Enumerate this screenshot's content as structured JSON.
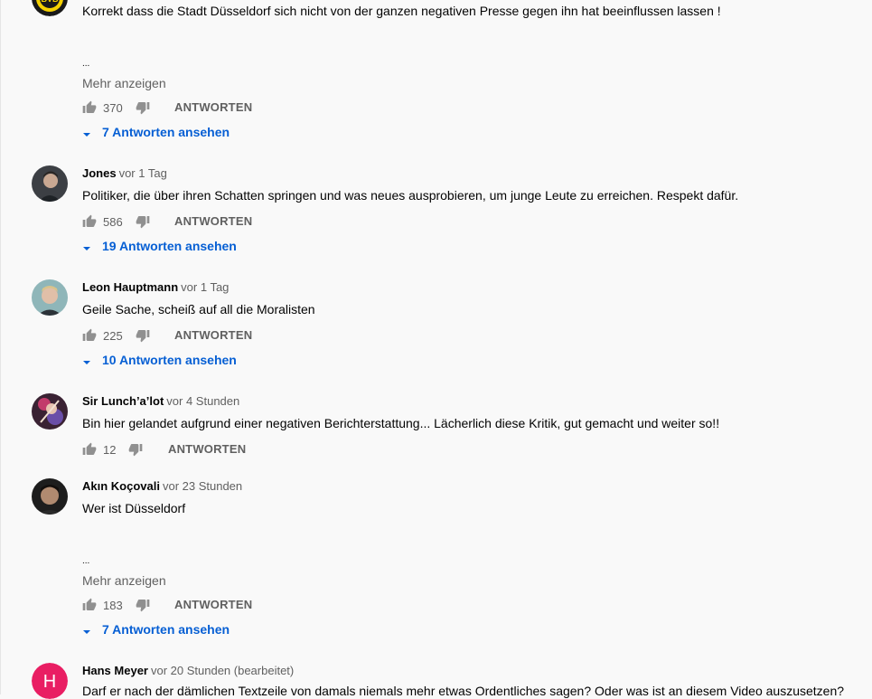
{
  "comments": [
    {
      "author": "",
      "time": "",
      "text": "Korrekt dass die Stadt Düsseldorf sich nicht von der ganzen negativen Presse gegen ihn hat beeinflussen lassen !",
      "ellipsis": "...",
      "show_more": "Mehr anzeigen",
      "likes": "370",
      "reply_label": "ANTWORTEN",
      "replies": "7 Antworten ansehen",
      "avatar_icon": "bvb-logo-avatar"
    },
    {
      "author": "Jones",
      "time": "vor 1 Tag",
      "text": "Politiker, die über ihren Schatten springen und was neues ausprobieren, um junge Leute zu erreichen. Respekt dafür.",
      "likes": "586",
      "reply_label": "ANTWORTEN",
      "replies": "19 Antworten ansehen",
      "avatar_icon": "user-photo-avatar"
    },
    {
      "author": "Leon Hauptmann",
      "time": "vor 1 Tag",
      "text": "Geile Sache, scheiß auf all die Moralisten",
      "likes": "225",
      "reply_label": "ANTWORTEN",
      "replies": "10 Antworten ansehen",
      "avatar_icon": "user-photo-avatar"
    },
    {
      "author": "Sir Lunch’a’lot",
      "time": "vor 4 Stunden",
      "text": "Bin hier gelandet aufgrund einer negativen Berichterstattung... Lächerlich diese Kritik, gut gemacht und weiter so!!",
      "likes": "12",
      "reply_label": "ANTWORTEN",
      "avatar_icon": "user-photo-avatar"
    },
    {
      "author": "Akın Koçovali",
      "time": "vor 23 Stunden",
      "text": "Wer ist Düsseldorf",
      "ellipsis": "...",
      "show_more": "Mehr anzeigen",
      "likes": "183",
      "reply_label": "ANTWORTEN",
      "replies": "7 Antworten ansehen",
      "avatar_icon": "user-photo-avatar"
    },
    {
      "author": "Hans Meyer",
      "time": "vor 20 Stunden (bearbeitet)",
      "text": "Darf er nach der dämlichen Textzeile von damals niemals mehr etwas Ordentliches sagen? Oder was ist an diesem Video auszusetzen?",
      "avatar_letter": "H",
      "avatar_color": "#e91e63",
      "avatar_icon": "letter-avatar"
    }
  ],
  "colors": {
    "link_blue": "#065fd4",
    "secondary_text": "#606060",
    "background": "#f9f9f9"
  },
  "icons": [
    "thumb-up-icon",
    "thumb-down-icon",
    "chevron-down-icon"
  ]
}
